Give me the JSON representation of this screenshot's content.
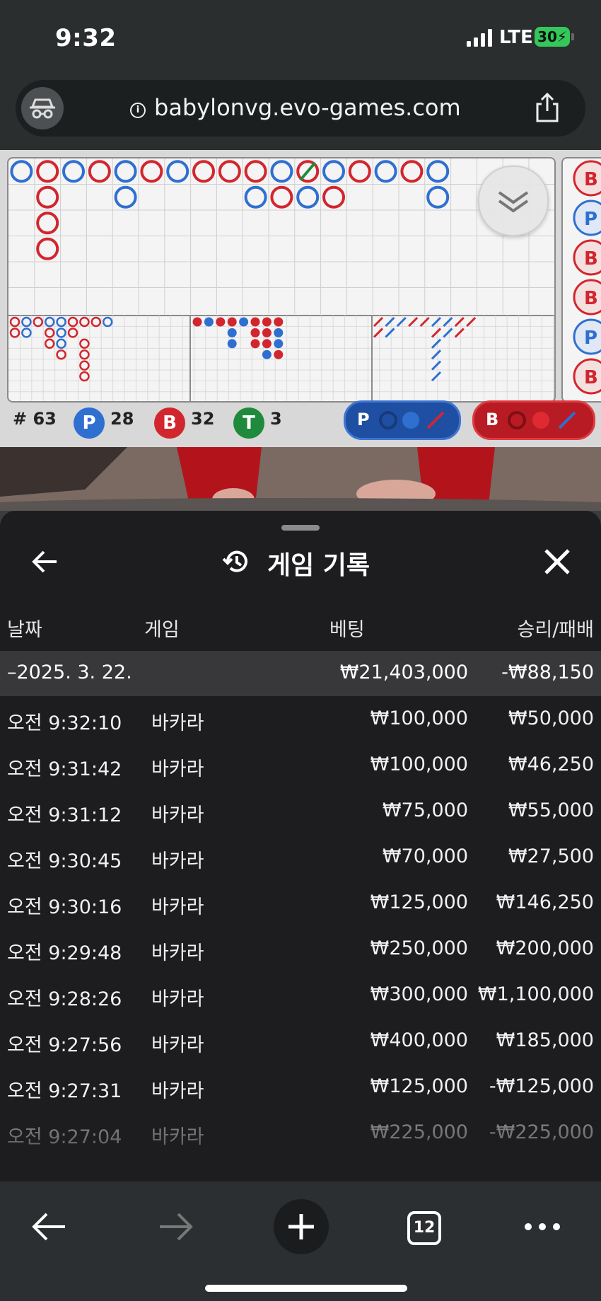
{
  "status_bar": {
    "time": "9:32",
    "carrier": "LTE",
    "battery": "30"
  },
  "browser": {
    "url": "babylonvg.evo-games.com"
  },
  "roadmap": {
    "stats": {
      "count_label": "# 63",
      "player_letter": "P",
      "player_count": "28",
      "banker_letter": "B",
      "banker_count": "32",
      "tie_letter": "T",
      "tie_count": "3"
    },
    "predict_player_letter": "P",
    "predict_banker_letter": "B",
    "side_letters": [
      "B",
      "P",
      "B",
      "B",
      "P",
      "B"
    ],
    "colors": {
      "player": "#2f6fd0",
      "banker": "#d2262e",
      "tie": "#1f8a3c"
    }
  },
  "sheet": {
    "title": "게임 기록",
    "headers": {
      "date": "날짜",
      "game": "게임",
      "bet": "베팅",
      "result": "승리/패배"
    },
    "date_group": {
      "date": "–2025. 3. 22.",
      "total_bet": "₩21,403,000",
      "total_result": "-₩88,150"
    },
    "rows": [
      {
        "time": "오전 9:32:10",
        "game": "바카라",
        "bet": "₩100,000",
        "result": "₩50,000"
      },
      {
        "time": "오전 9:31:42",
        "game": "바카라",
        "bet": "₩100,000",
        "result": "₩46,250"
      },
      {
        "time": "오전 9:31:12",
        "game": "바카라",
        "bet": "₩75,000",
        "result": "₩55,000"
      },
      {
        "time": "오전 9:30:45",
        "game": "바카라",
        "bet": "₩70,000",
        "result": "₩27,500"
      },
      {
        "time": "오전 9:30:16",
        "game": "바카라",
        "bet": "₩125,000",
        "result": "₩146,250"
      },
      {
        "time": "오전 9:29:48",
        "game": "바카라",
        "bet": "₩250,000",
        "result": "₩200,000"
      },
      {
        "time": "오전 9:28:26",
        "game": "바카라",
        "bet": "₩300,000",
        "result": "₩1,100,000"
      },
      {
        "time": "오전 9:27:56",
        "game": "바카라",
        "bet": "₩400,000",
        "result": "₩185,000"
      },
      {
        "time": "오전 9:27:31",
        "game": "바카라",
        "bet": "₩125,000",
        "result": "-₩125,000"
      },
      {
        "time": "오전 9:27:04",
        "game": "바카라",
        "bet": "₩225,000",
        "result": "-₩225,000"
      }
    ]
  },
  "toolbar": {
    "tabs_count": "12"
  }
}
